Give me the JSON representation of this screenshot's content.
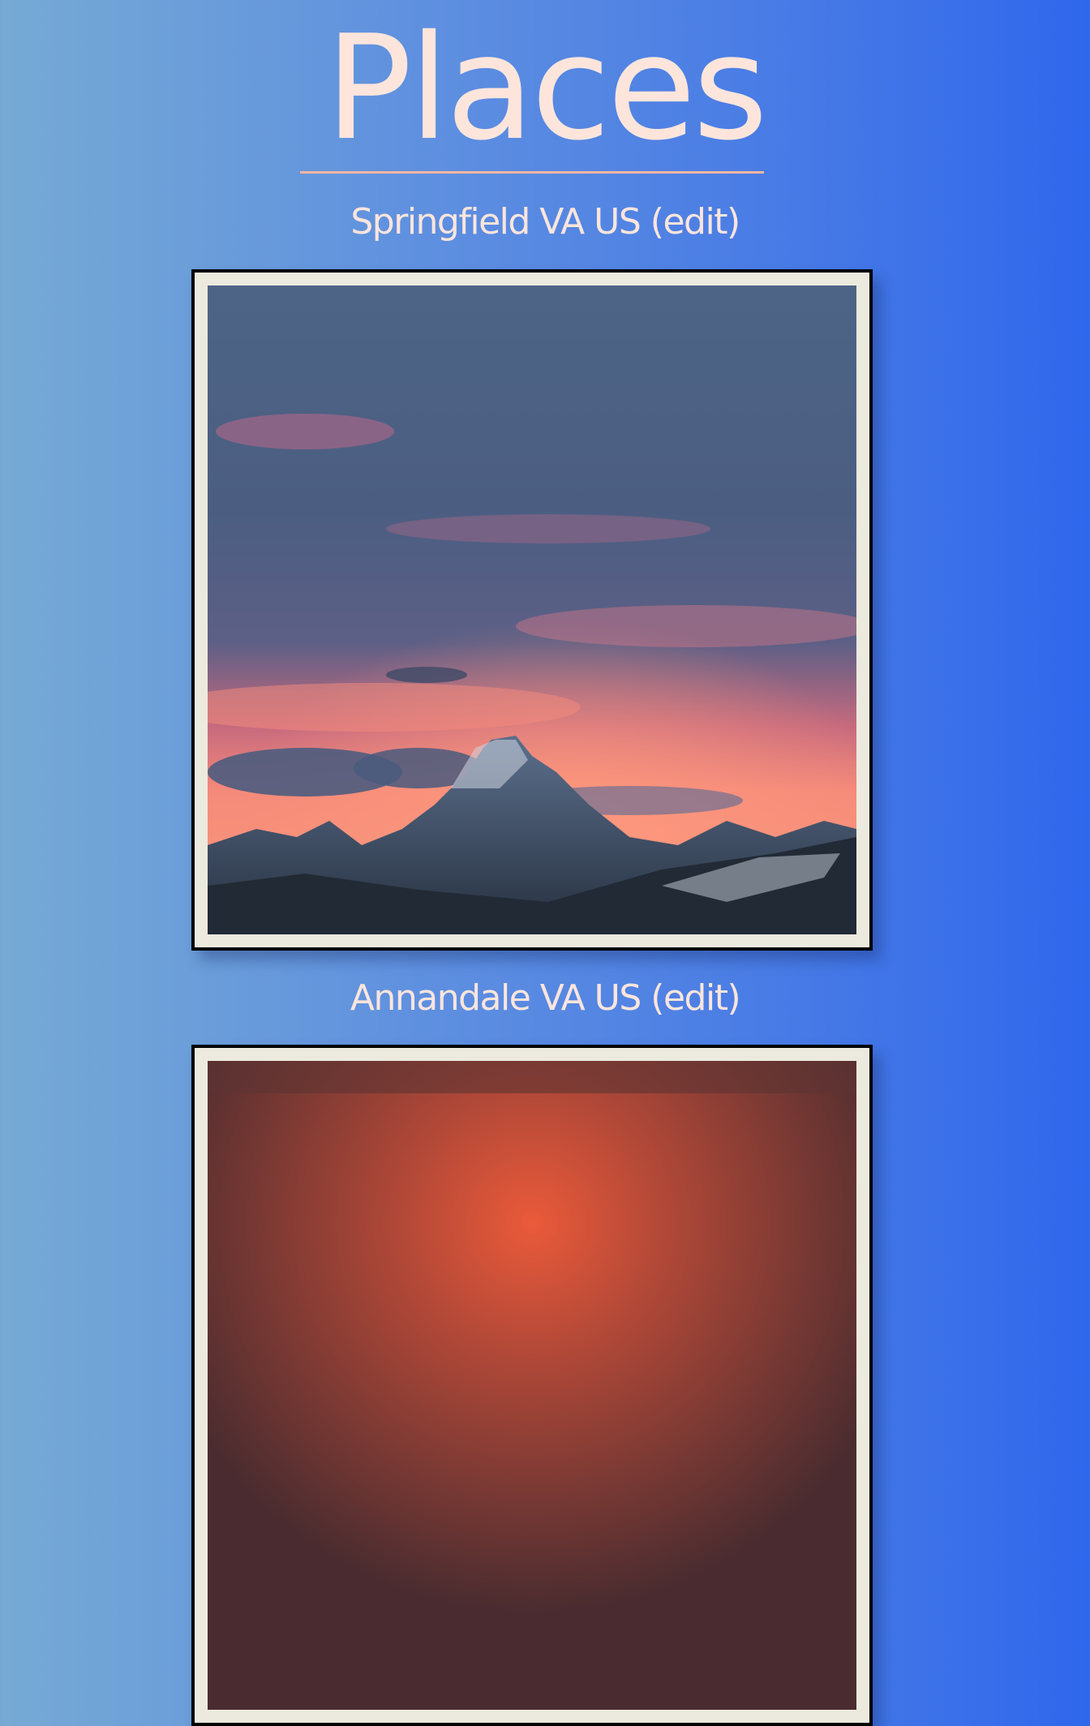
{
  "page": {
    "title": "Places"
  },
  "places": [
    {
      "name": "Springfield VA US",
      "edit_label": "(edit)",
      "photo": "mountain-sunset-photo"
    },
    {
      "name": "Annandale VA US",
      "edit_label": "(edit)",
      "photo": "red-sunset-photo"
    }
  ],
  "colors": {
    "title": "#fde5dc",
    "rule": "#f4b6a3",
    "frame_border": "#000000",
    "frame_mat": "#eceade",
    "background_left": "#76aad4",
    "background_right": "#2f67ec"
  }
}
